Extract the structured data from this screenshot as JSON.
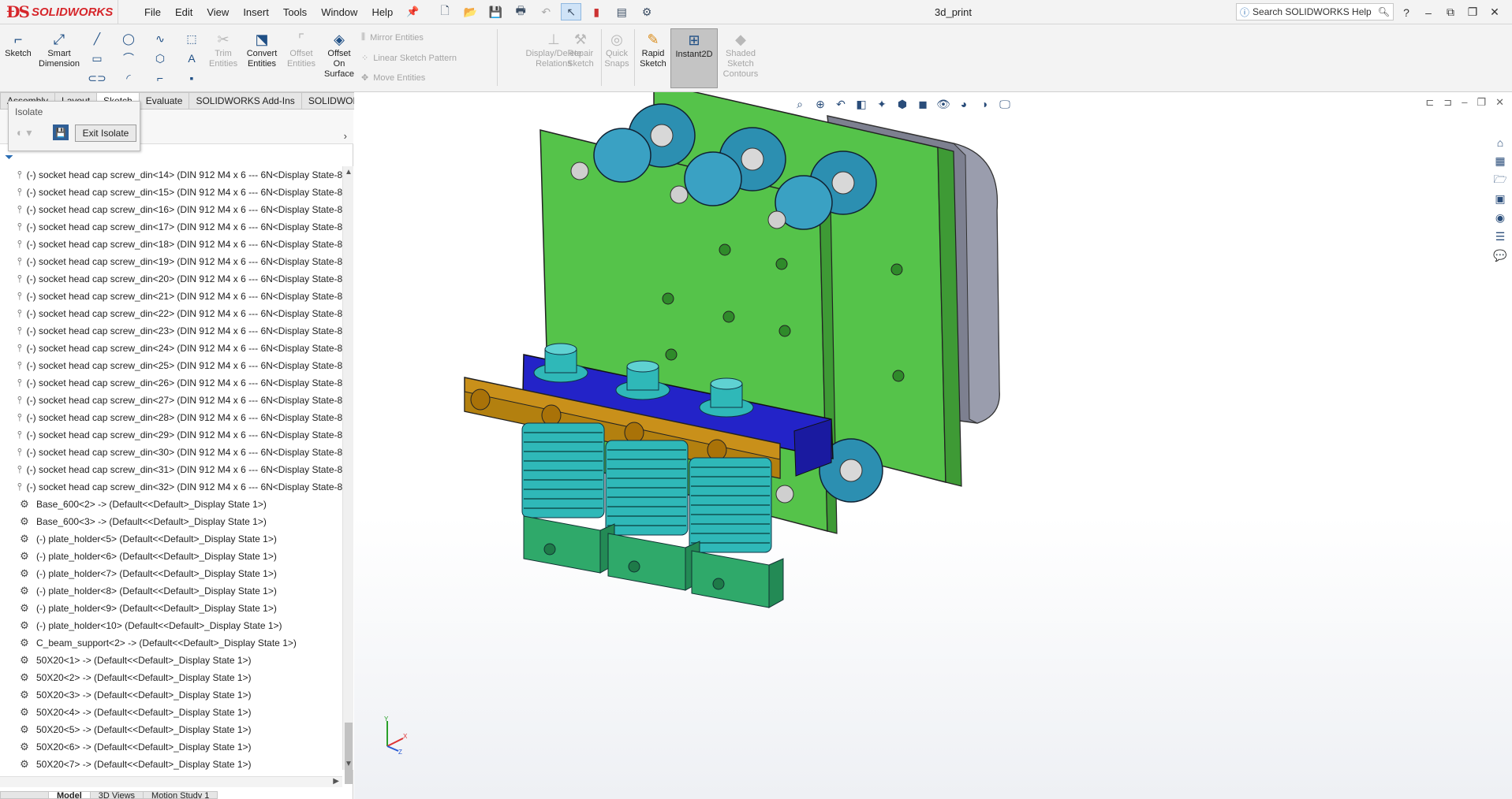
{
  "app": {
    "logo_text": "SOLIDWORKS",
    "document_title": "3d_print"
  },
  "menu": [
    "File",
    "Edit",
    "View",
    "Insert",
    "Tools",
    "Window",
    "Help"
  ],
  "search": {
    "placeholder": "Search SOLIDWORKS Help"
  },
  "ribbon": {
    "sketch": "Sketch",
    "smart_dimension": "Smart Dimension",
    "trim_entities": "Trim Entities",
    "convert_entities": "Convert Entities",
    "offset_entities": "Offset Entities",
    "offset_on_surface": "Offset On Surface",
    "mirror_entities": "Mirror Entities",
    "linear_sketch_pattern": "Linear Sketch Pattern",
    "move_entities": "Move Entities",
    "display_delete_relations": "Display/Delete Relations",
    "repair_sketch": "Repair Sketch",
    "quick_snaps": "Quick Snaps",
    "rapid_sketch": "Rapid Sketch",
    "instant2d": "Instant2D",
    "shaded_sketch_contours": "Shaded Sketch Contours"
  },
  "tabs": [
    "Assembly",
    "Layout",
    "Sketch",
    "Evaluate",
    "SOLIDWORKS Add-Ins",
    "SOLIDWORKS MBD"
  ],
  "isolate": {
    "title": "Isolate",
    "exit_label": "Exit Isolate"
  },
  "tree_items": [
    "(-) socket head cap screw_din<14> (DIN 912 M4 x 6 --- 6N<Display State-8",
    "(-) socket head cap screw_din<15> (DIN 912 M4 x 6 --- 6N<Display State-8",
    "(-) socket head cap screw_din<16> (DIN 912 M4 x 6 --- 6N<Display State-8",
    "(-) socket head cap screw_din<17> (DIN 912 M4 x 6 --- 6N<Display State-8",
    "(-) socket head cap screw_din<18> (DIN 912 M4 x 6 --- 6N<Display State-8",
    "(-) socket head cap screw_din<19> (DIN 912 M4 x 6 --- 6N<Display State-8",
    "(-) socket head cap screw_din<20> (DIN 912 M4 x 6 --- 6N<Display State-8",
    "(-) socket head cap screw_din<21> (DIN 912 M4 x 6 --- 6N<Display State-8",
    "(-) socket head cap screw_din<22> (DIN 912 M4 x 6 --- 6N<Display State-8",
    "(-) socket head cap screw_din<23> (DIN 912 M4 x 6 --- 6N<Display State-8",
    "(-) socket head cap screw_din<24> (DIN 912 M4 x 6 --- 6N<Display State-8",
    "(-) socket head cap screw_din<25> (DIN 912 M4 x 6 --- 6N<Display State-8",
    "(-) socket head cap screw_din<26> (DIN 912 M4 x 6 --- 6N<Display State-8",
    "(-) socket head cap screw_din<27> (DIN 912 M4 x 6 --- 6N<Display State-8",
    "(-) socket head cap screw_din<28> (DIN 912 M4 x 6 --- 6N<Display State-8",
    "(-) socket head cap screw_din<29> (DIN 912 M4 x 6 --- 6N<Display State-8",
    "(-) socket head cap screw_din<30> (DIN 912 M4 x 6 --- 6N<Display State-8",
    "(-) socket head cap screw_din<31> (DIN 912 M4 x 6 --- 6N<Display State-8",
    "(-) socket head cap screw_din<32> (DIN 912 M4 x 6 --- 6N<Display State-8",
    "Base_600<2> -> (Default<<Default>_Display State 1>)",
    "Base_600<3> -> (Default<<Default>_Display State 1>)",
    "(-) plate_holder<5> (Default<<Default>_Display State 1>)",
    "(-) plate_holder<6> (Default<<Default>_Display State 1>)",
    "(-) plate_holder<7> (Default<<Default>_Display State 1>)",
    "(-) plate_holder<8> (Default<<Default>_Display State 1>)",
    "(-) plate_holder<9> (Default<<Default>_Display State 1>)",
    "(-) plate_holder<10> (Default<<Default>_Display State 1>)",
    "C_beam_support<2> -> (Default<<Default>_Display State 1>)",
    "50X20<1> -> (Default<<Default>_Display State 1>)",
    "50X20<2> -> (Default<<Default>_Display State 1>)",
    "50X20<3> -> (Default<<Default>_Display State 1>)",
    "50X20<4> -> (Default<<Default>_Display State 1>)",
    "50X20<5> -> (Default<<Default>_Display State 1>)",
    "50X20<6> -> (Default<<Default>_Display State 1>)",
    "50X20<7> -> (Default<<Default>_Display State 1>)"
  ],
  "bottom_tabs": [
    "Model",
    "3D Views",
    "Motion Study 1"
  ],
  "colors": {
    "plate_green": "#55c34a",
    "wheel_blue": "#2c8fb1",
    "block_blue": "#2323c8",
    "bar_orange": "#c9901a",
    "nozzle_teal": "#2fb8b8",
    "motor_grey": "#7d8090"
  }
}
